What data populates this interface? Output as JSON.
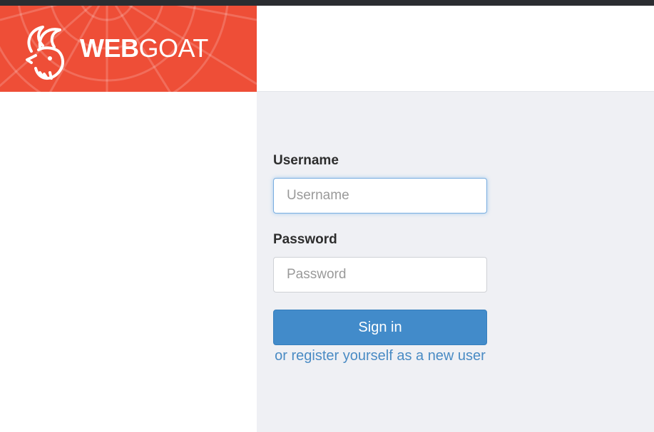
{
  "brand": {
    "bold": "WEB",
    "light": "GOAT",
    "logo_icon": "goat-icon"
  },
  "colors": {
    "brand_red": "#ee4e37",
    "primary_button": "#428bca",
    "link": "#4a8bc4",
    "main_background": "#eff0f4"
  },
  "login": {
    "username_label": "Username",
    "username_placeholder": "Username",
    "username_value": "",
    "password_label": "Password",
    "password_placeholder": "Password",
    "password_value": "",
    "submit_label": "Sign in",
    "register_link": "or register yourself as a new user"
  }
}
